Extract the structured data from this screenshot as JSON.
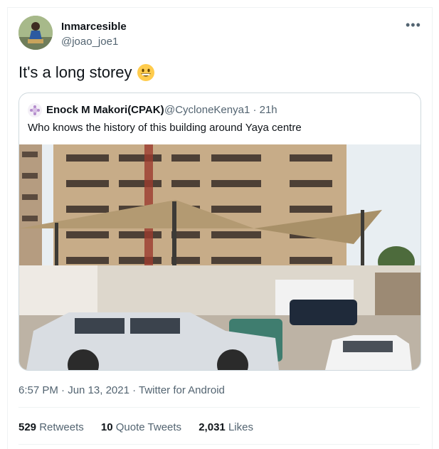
{
  "author": {
    "name": "Inmarcesible",
    "handle": "@joao_joe1"
  },
  "tweet": {
    "text": "It's a long storey",
    "emoji": "grinning-face-icon"
  },
  "quoted": {
    "name": "Enock M Makori(CPAK)",
    "handle_time": "@CycloneKenya1 · 21h",
    "text": "Who knows the history of this building around Yaya centre"
  },
  "meta": {
    "timestamp": "6:57 PM · Jun 13, 2021 · Twitter for Android"
  },
  "stats": {
    "retweets_count": "529",
    "retweets_label": "Retweets",
    "quotes_count": "10",
    "quotes_label": "Quote Tweets",
    "likes_count": "2,031",
    "likes_label": "Likes"
  },
  "menu_icon": "more-horizontal-icon"
}
